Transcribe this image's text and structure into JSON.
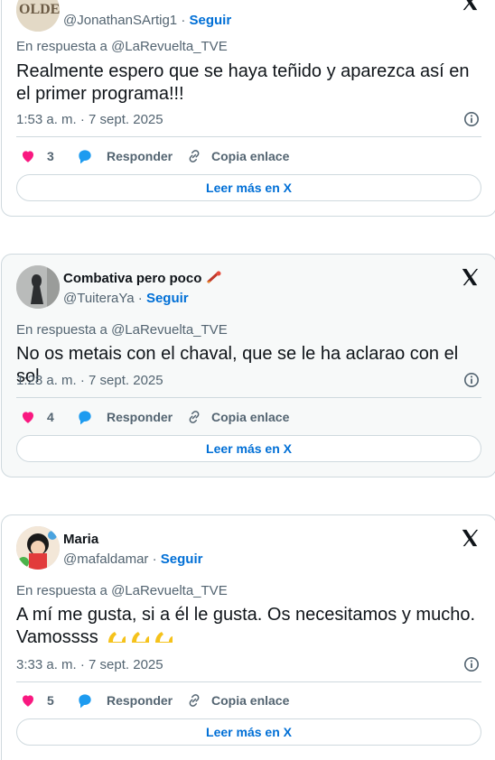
{
  "tweets": [
    {
      "display_name": "",
      "handle": "@JonathanSArtig1",
      "follow_label": "Seguir",
      "reply_to": "En respuesta a @LaRevuelta_TVE",
      "text": "Realmente espero que se haya teñido y aparezca así en el primer programa!!!",
      "timestamp": "1:53 a. m. · 7 sept. 2025",
      "likes": "3",
      "reply_label": "Responder",
      "copy_label": "Copia enlace",
      "read_more": "Leer más en X"
    },
    {
      "display_name": "Combativa pero poco",
      "handle": "@TuiteraYa",
      "follow_label": "Seguir",
      "reply_to": "En respuesta a @LaRevuelta_TVE",
      "text": "No os metais con el chaval, que se le ha aclarao con el sol",
      "timestamp": "1:28 a. m. · 7 sept. 2025",
      "likes": "4",
      "reply_label": "Responder",
      "copy_label": "Copia enlace",
      "read_more": "Leer más en X"
    },
    {
      "display_name": "Maria",
      "handle": "@mafaldamar",
      "follow_label": "Seguir",
      "reply_to": "En respuesta a @LaRevuelta_TVE",
      "text_line1": "A mí me gusta, si a él le gusta. Os necesitamos y mucho.",
      "text_line2": "Vamossss",
      "timestamp": "3:33 a. m. · 7 sept. 2025",
      "likes": "5",
      "reply_label": "Responder",
      "copy_label": "Copia enlace",
      "read_more": "Leer más en X"
    }
  ],
  "colors": {
    "like": "#f91880",
    "reply": "#1d9bf0",
    "link": "#006fd6",
    "muted": "#536471",
    "border": "#cfd9de"
  }
}
